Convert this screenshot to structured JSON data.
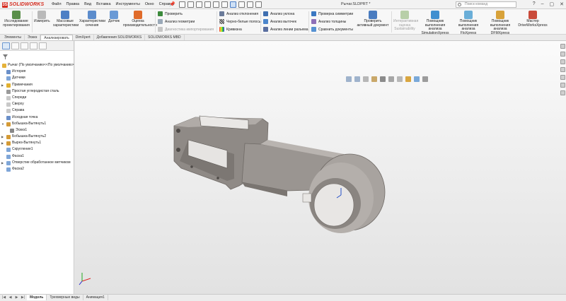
{
  "app": {
    "brand": "SOLIDWORKS",
    "doc_title": "Рычаг.SLDPRT *",
    "search_placeholder": "Поиск команд"
  },
  "menu": [
    "Файл",
    "Правка",
    "Вид",
    "Вставка",
    "Инструменты",
    "Окно",
    "Справка"
  ],
  "ribbon": {
    "design_study": "Исследование проектирования",
    "measure": "Измерить",
    "mass_props": "Массовые характеристики",
    "section_props": "Характеристики сечения",
    "sensor": "Датчик",
    "perf_eval": "Оценка производительности",
    "check": "Проверить",
    "geom_analysis": "Анализ геометрии",
    "draft_analysis": "Диагностика импортирования",
    "deviation": "Анализ отклонения",
    "zebra": "Черно-белые полосы",
    "curvature": "Кривизна",
    "undercut": "Анализ уклона",
    "undercut2": "Анализ выточек",
    "parting": "Анализ линии разъема",
    "symmetry": "Проверка симметрии",
    "thickness": "Анализ толщины",
    "compare": "Сравнить документы",
    "check_active": "Проверить активный документ",
    "sim_advisor": "Помощник выполнения анализа SimulationXpress",
    "floxpress": "Помощник выполнения анализа FloXpress",
    "dfm": "Помощник выполнения анализа DFMXpress",
    "driveworks": "Мастер DriveWorksXpress",
    "sustain": "Интерактивная оценка Sustainability"
  },
  "tabs": [
    "Элементы",
    "Эскиз",
    "Анализировать",
    "DimXpert",
    "Добавления SOLIDWORKS",
    "SOLIDWORKS MBD"
  ],
  "active_tab": 2,
  "tree": {
    "root": "Рычаг  (По умолчанию<<По умолчанию>",
    "items": [
      {
        "label": "История",
        "arrow": "",
        "indent": 1,
        "color": "#6a8fc9"
      },
      {
        "label": "Датчики",
        "arrow": "",
        "indent": 1,
        "color": "#7fa6d8"
      },
      {
        "label": "Примечания",
        "arrow": "▶",
        "indent": 1,
        "color": "#e0b030"
      },
      {
        "label": "Простая углеродистая сталь",
        "arrow": "",
        "indent": 1,
        "color": "#9a9a9a"
      },
      {
        "label": "Спереди",
        "arrow": "",
        "indent": 1,
        "color": "#c9c9c9"
      },
      {
        "label": "Сверху",
        "arrow": "",
        "indent": 1,
        "color": "#c9c9c9"
      },
      {
        "label": "Справа",
        "arrow": "",
        "indent": 1,
        "color": "#c9c9c9"
      },
      {
        "label": "Исходная точка",
        "arrow": "",
        "indent": 1,
        "color": "#6a8fc9"
      },
      {
        "label": "Бобышка-Вытянуть1",
        "arrow": "▼",
        "indent": 1,
        "color": "#d49a36"
      },
      {
        "label": "Эскиз1",
        "arrow": "",
        "indent": 2,
        "color": "#888888"
      },
      {
        "label": "Бобышка-Вытянуть2",
        "arrow": "▶",
        "indent": 1,
        "color": "#d49a36"
      },
      {
        "label": "Вырез-Вытянуть1",
        "arrow": "▶",
        "indent": 1,
        "color": "#d49a36"
      },
      {
        "label": "Скругление1",
        "arrow": "",
        "indent": 1,
        "color": "#7fa6d8"
      },
      {
        "label": "Фаска1",
        "arrow": "",
        "indent": 1,
        "color": "#7fa6d8"
      },
      {
        "label": "Отверстие обработанное метчиком",
        "arrow": "▶",
        "indent": 1,
        "color": "#7fa6d8"
      },
      {
        "label": "Фаска2",
        "arrow": "",
        "indent": 1,
        "color": "#7fa6d8"
      }
    ]
  },
  "bottom_tabs": [
    "Модель",
    "Трехмерные виды",
    "Анимация1"
  ],
  "active_bottom_tab": 0
}
